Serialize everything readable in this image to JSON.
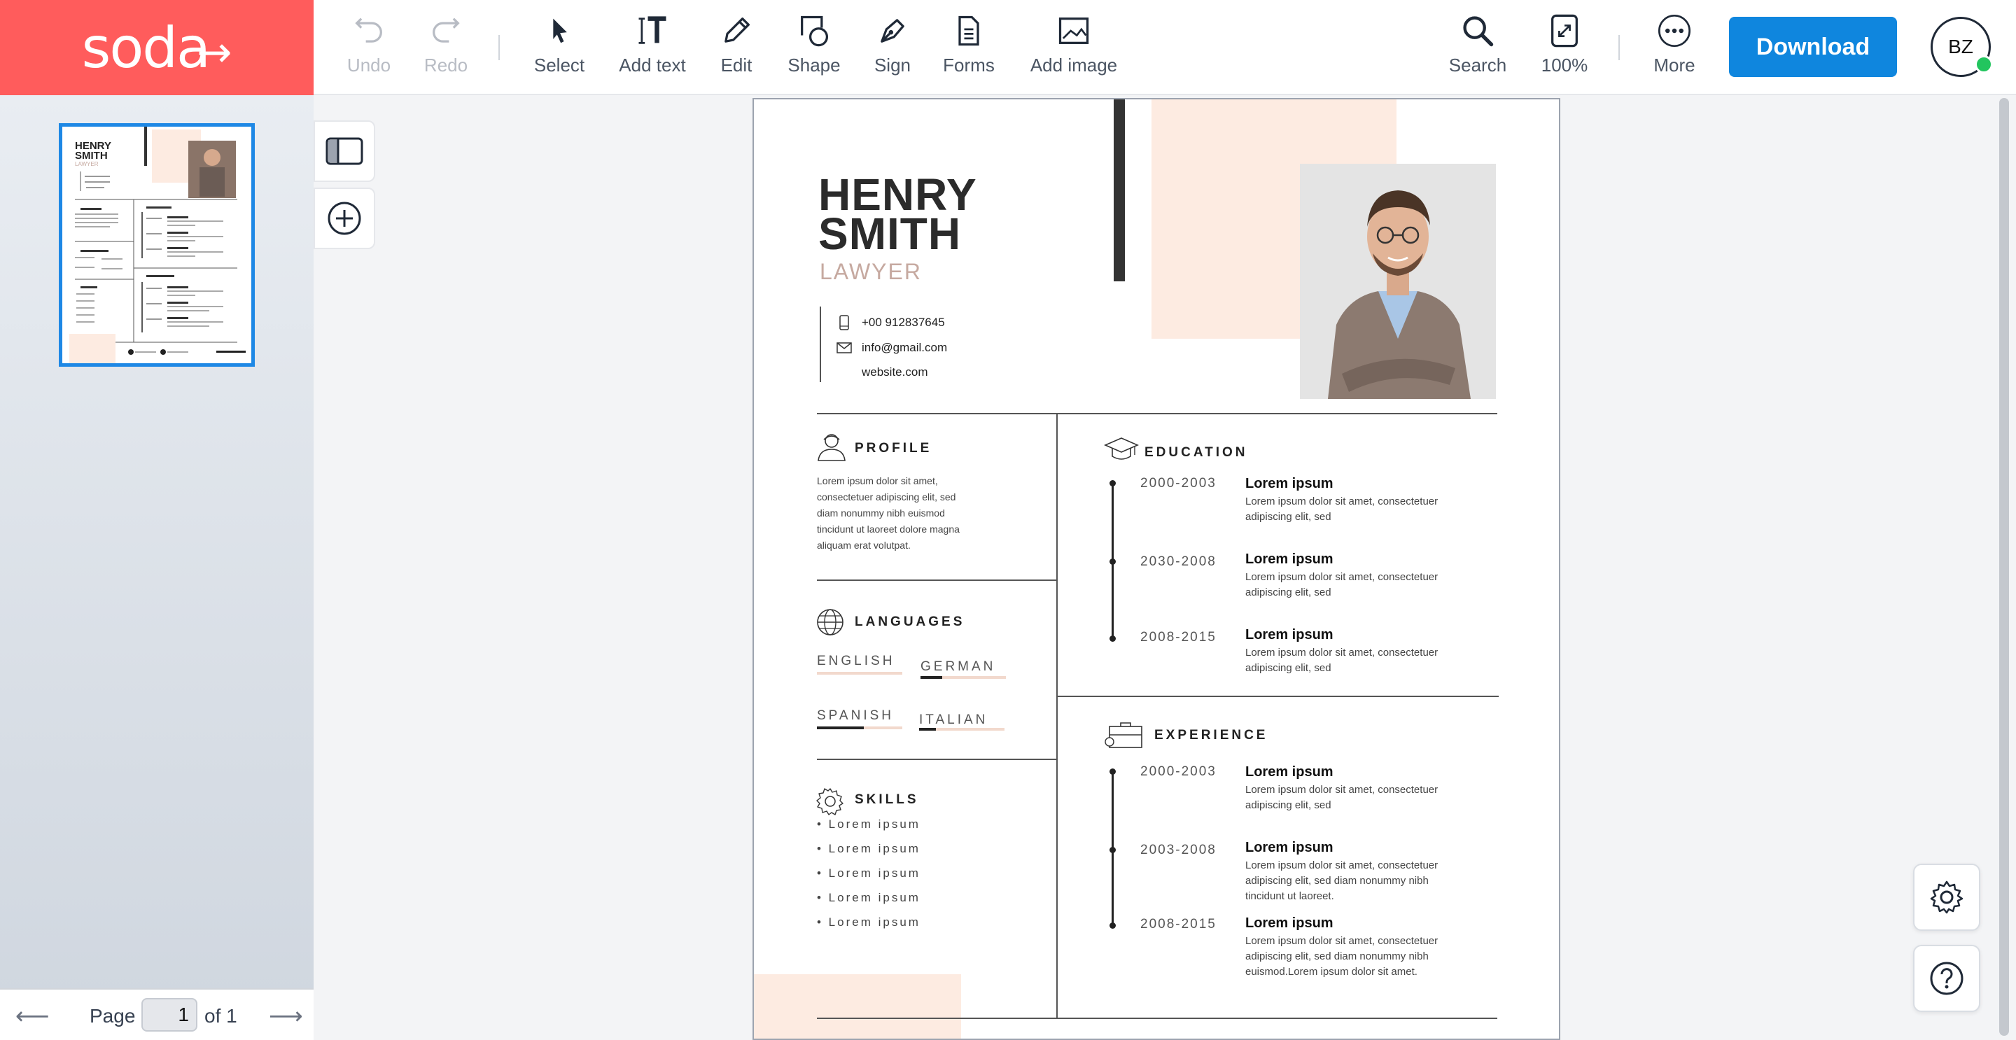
{
  "app": {
    "logo_text": "soda",
    "logo_arrow": "→",
    "brand_color": "#ff5c5c",
    "accent_color": "#0f86de"
  },
  "toolbar": {
    "undo": "Undo",
    "redo": "Redo",
    "select": "Select",
    "add_text": "Add text",
    "edit": "Edit",
    "shape": "Shape",
    "sign": "Sign",
    "forms": "Forms",
    "add_image": "Add image",
    "search": "Search",
    "zoom": "100%",
    "more": "More",
    "download": "Download",
    "avatar_initials": "BZ"
  },
  "pager": {
    "label": "Page",
    "current": "1",
    "of": "of 1"
  },
  "resume": {
    "first_name": "HENRY",
    "last_name": "SMITH",
    "role": "LAWYER",
    "phone": "+00 912837645",
    "email": "info@gmail.com",
    "website": "website.com",
    "profile": {
      "title": "PROFILE",
      "lines": [
        "Lorem ipsum dolor sit amet,",
        "consectetuer adipiscing elit, sed",
        "diam nonummy nibh euismod",
        "tincidunt ut laoreet dolore magna",
        "aliquam erat volutpat."
      ]
    },
    "languages": {
      "title": "LANGUAGES",
      "items": [
        {
          "name": "ENGLISH",
          "level": 0.0
        },
        {
          "name": "GERMAN",
          "level": 0.25
        },
        {
          "name": "SPANISH",
          "level": 0.55
        },
        {
          "name": "ITALIAN",
          "level": 0.2
        }
      ]
    },
    "skills": {
      "title": "SKILLS",
      "items": [
        "• Lorem ipsum",
        "• Lorem ipsum",
        "• Lorem ipsum",
        "• Lorem ipsum",
        "• Lorem ipsum"
      ]
    },
    "education": {
      "title": "EDUCATION",
      "entries": [
        {
          "date": "2000-2003",
          "heading": "Lorem ipsum",
          "lines": [
            "Lorem ipsum dolor sit amet, consectetuer",
            "adipiscing elit, sed"
          ]
        },
        {
          "date": "2030-2008",
          "heading": "Lorem ipsum",
          "lines": [
            "Lorem ipsum dolor sit amet, consectetuer",
            "adipiscing elit, sed"
          ]
        },
        {
          "date": "2008-2015",
          "heading": "Lorem ipsum",
          "lines": [
            "Lorem ipsum dolor sit amet, consectetuer",
            "adipiscing elit, sed"
          ]
        }
      ]
    },
    "experience": {
      "title": "EXPERIENCE",
      "entries": [
        {
          "date": "2000-2003",
          "heading": "Lorem ipsum",
          "lines": [
            "Lorem ipsum dolor sit amet, consectetuer",
            "adipiscing elit, sed"
          ]
        },
        {
          "date": "2003-2008",
          "heading": "Lorem ipsum",
          "lines": [
            "Lorem ipsum dolor sit amet, consectetuer",
            "adipiscing elit, sed diam nonummy nibh",
            "tincidunt ut laoreet."
          ]
        },
        {
          "date": "2008-2015",
          "heading": "Lorem ipsum",
          "lines": [
            "Lorem ipsum dolor sit amet, consectetuer",
            "adipiscing elit, sed diam nonummy nibh",
            "euismod.Lorem ipsum dolor sit amet."
          ]
        }
      ]
    }
  },
  "thumbnail": {
    "first_name": "HENRY",
    "last_name": "SMITH",
    "role": "LAWYER"
  }
}
